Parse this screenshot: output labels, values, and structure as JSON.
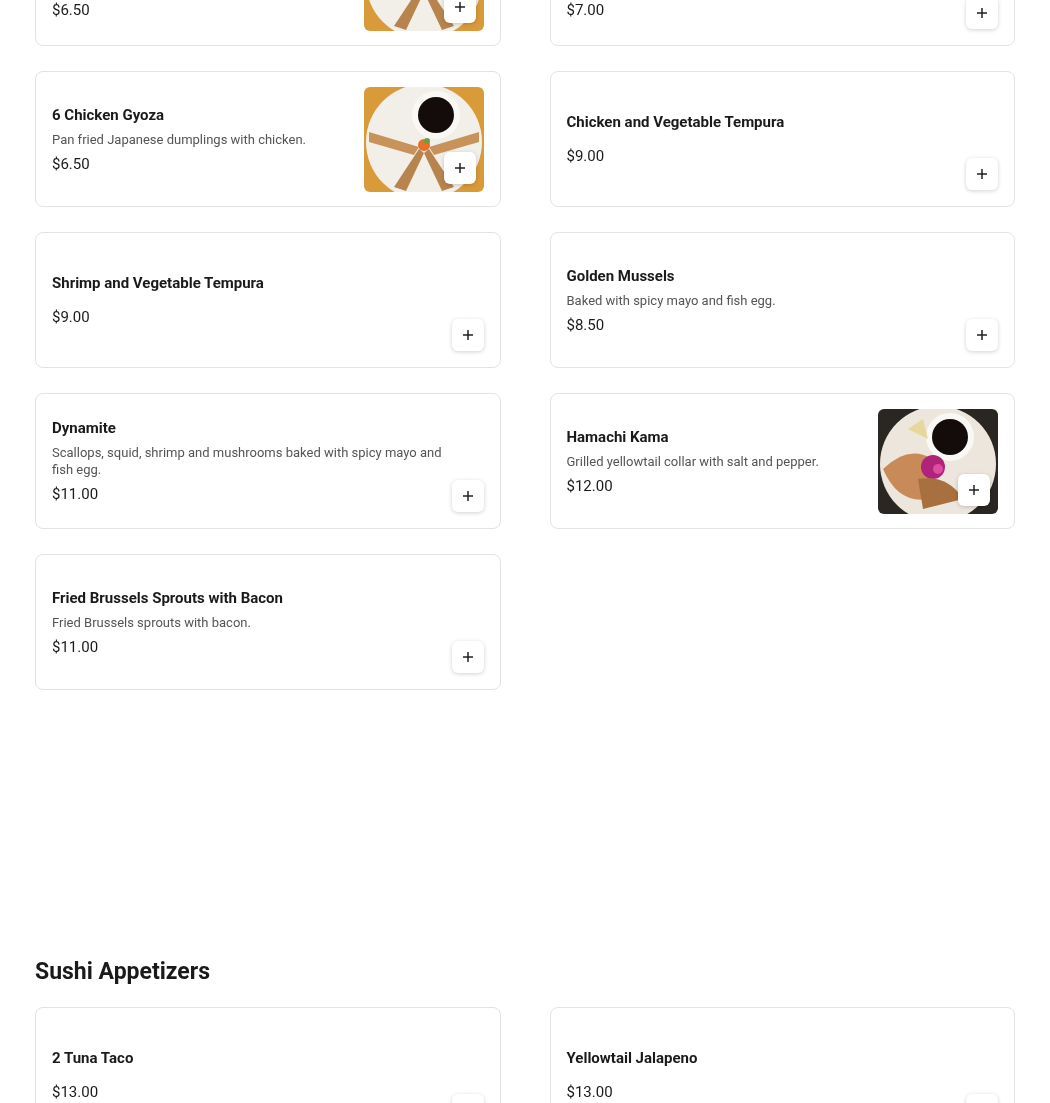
{
  "sections": [
    {
      "items": [
        {
          "price": "$6.50"
        },
        {
          "price": "$7.00"
        },
        {
          "title": "6 Chicken Gyoza",
          "description": "Pan fried Japanese dumplings with chicken.",
          "price": "$6.50"
        },
        {
          "title": "Chicken and Vegetable Tempura",
          "price": "$9.00"
        },
        {
          "title": "Shrimp and Vegetable Tempura",
          "price": "$9.00"
        },
        {
          "title": "Golden Mussels",
          "description": "Baked with spicy mayo and fish egg.",
          "price": "$8.50"
        },
        {
          "title": "Dynamite",
          "description": "Scallops, squid, shrimp and mushrooms baked with spicy mayo and fish egg.",
          "price": "$11.00"
        },
        {
          "title": "Hamachi Kama",
          "description": "Grilled yellowtail collar with salt and pepper.",
          "price": "$12.00"
        },
        {
          "title": "Fried Brussels Sprouts with Bacon",
          "description": "Fried Brussels sprouts with bacon.",
          "price": "$11.00"
        }
      ]
    },
    {
      "heading": "Sushi Appetizers",
      "items": [
        {
          "title": "2 Tuna Taco",
          "price": "$13.00"
        },
        {
          "title": "Yellowtail Jalapeno",
          "price": "$13.00"
        }
      ]
    }
  ]
}
